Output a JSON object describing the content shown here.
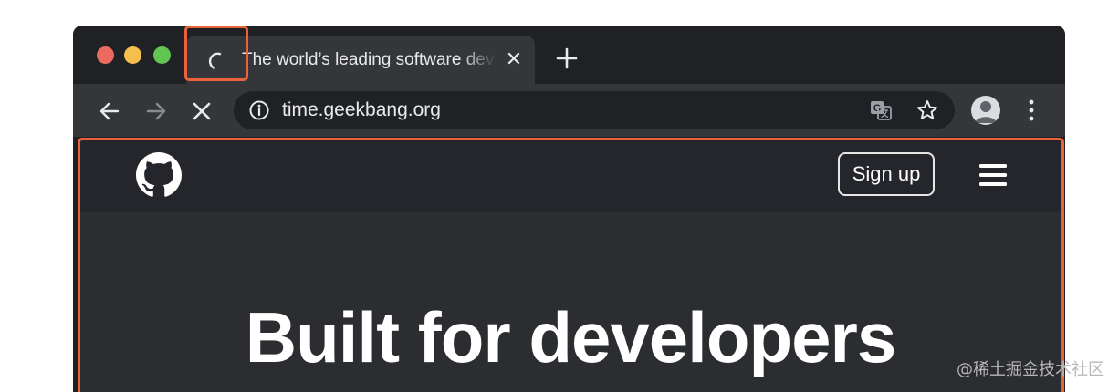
{
  "browser": {
    "tab": {
      "title": "The world’s leading software development platform",
      "state": "loading",
      "close_glyph": "✕"
    },
    "new_tab_icon": "plus-icon",
    "toolbar": {
      "back_icon": "arrow-left-icon",
      "forward_icon": "arrow-right-icon",
      "stop_icon": "close-icon",
      "url": "time.geekbang.org",
      "site_info_icon": "info-icon",
      "translate_icon": "translate-icon",
      "bookmark_icon": "star-icon",
      "profile_icon": "avatar",
      "menu_icon": "more-vertical-icon"
    }
  },
  "page": {
    "header": {
      "logo_icon": "github-icon",
      "signup_label": "Sign up",
      "menu_icon": "hamburger-icon"
    },
    "hero": {
      "title": "Built for developers"
    }
  },
  "watermark": "@稀土掘金技术社区",
  "colors": {
    "annotation": "#e8623a",
    "window_bg": "#202124",
    "toolbar_bg": "#35363a",
    "page_bg": "#2b2d31"
  }
}
